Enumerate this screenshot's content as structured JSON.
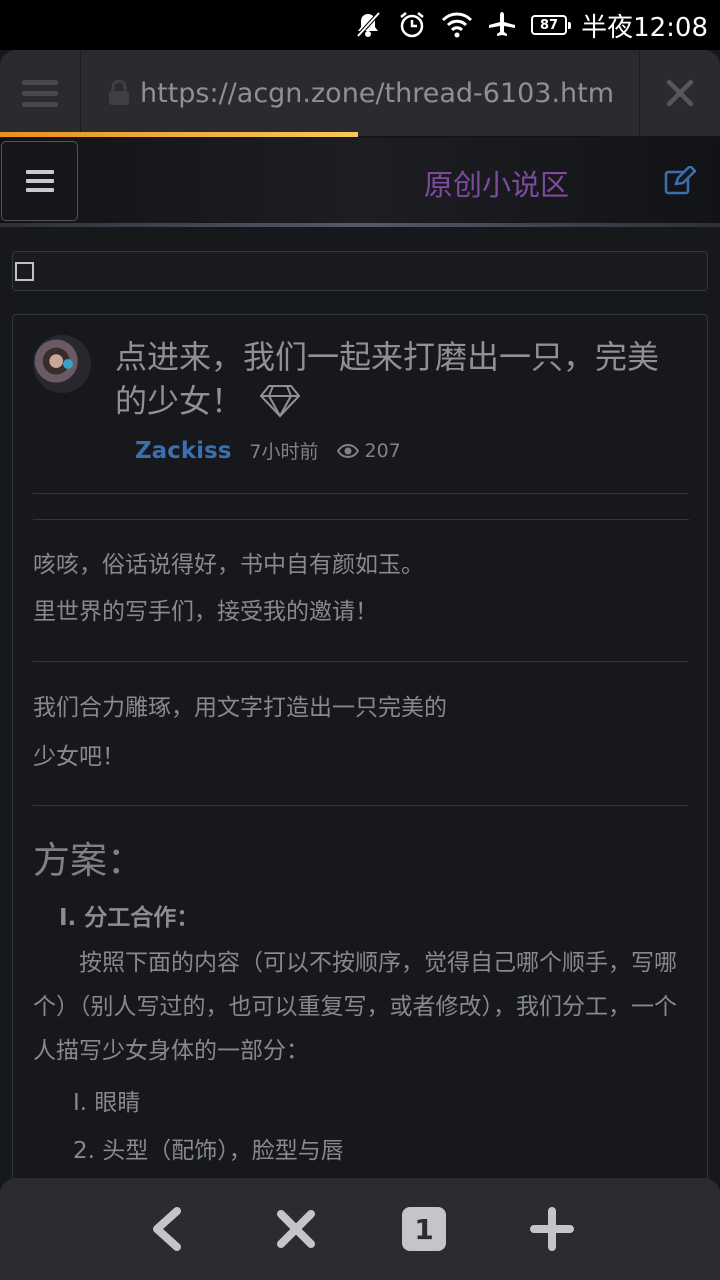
{
  "status_bar": {
    "icons": [
      "mute-icon",
      "alarm-icon",
      "wifi-icon",
      "airplane-icon"
    ],
    "battery": "87",
    "time": "半夜12:08"
  },
  "browser": {
    "url": "https://acgn.zone/thread-6103.htm",
    "progress": 0.5
  },
  "site_header": {
    "section_title": "原创小说区"
  },
  "post": {
    "title": "点进来，我们一起来打磨出一只，完美的少女！",
    "author": "Zackiss",
    "time": "7小时前",
    "views": "207",
    "paragraph1_line1": "咳咳，俗话说得好，书中自有颜如玉。",
    "paragraph1_line2": "里世界的写手们，接受我的邀请！",
    "paragraph2_line1": "我们合力雕琢，用文字打造出一只完美的",
    "paragraph2_line2": "少女吧！",
    "heading": "方案：",
    "section1_title": "I. 分工合作：",
    "section1_body": "按照下面的内容（可以不按顺序，觉得自己哪个顺手，写哪个）（别人写过的，也可以重复写，或者修改），我们分工，一个人描写少女身体的一部分：",
    "list": [
      "I.  眼睛",
      "2. 头型（配饰），脸型与唇"
    ]
  },
  "bottom_bar": {
    "tab_count": "1"
  },
  "colors": {
    "accent_purple": "#7d4a9e",
    "author_blue": "#3d6fae",
    "progress_orange": "#f0a030"
  }
}
